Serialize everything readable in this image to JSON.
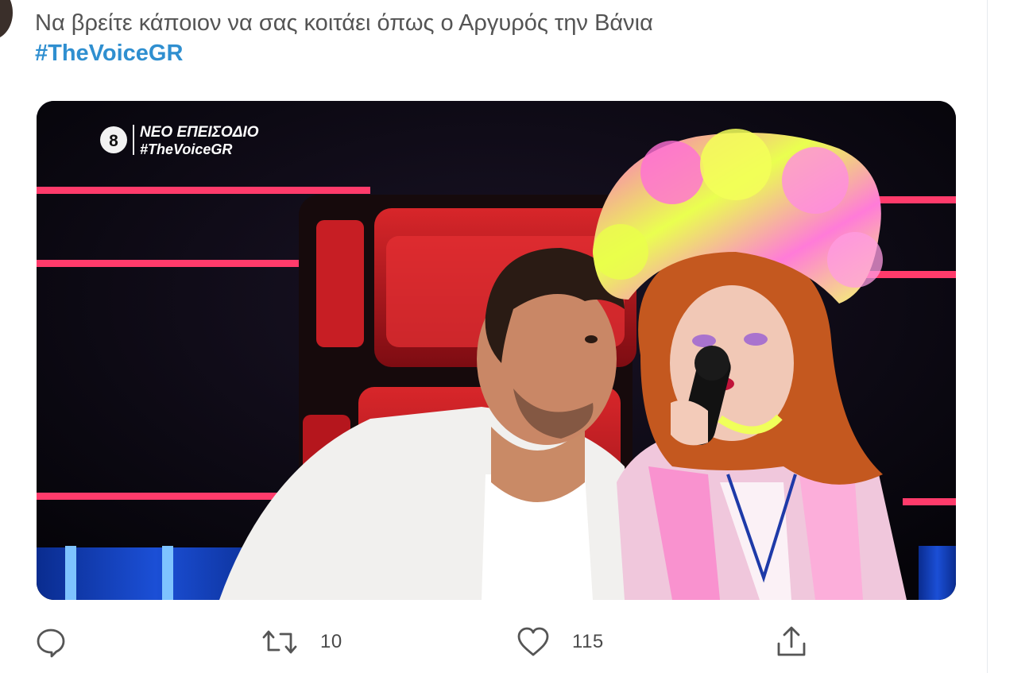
{
  "tweet": {
    "text": "Να βρείτε κάποιον να σας κοιτάει όπως ο Αργυρός την Βάνια",
    "hashtag": "#TheVoiceGR"
  },
  "media": {
    "badge_number": "8",
    "overlay_title": "ΝΕΟ ΕΠΕΙΣΟΔΙΟ",
    "overlay_hashtag": "#TheVoiceGR"
  },
  "actions": {
    "reply": {
      "icon": "reply-icon",
      "count": ""
    },
    "retweet": {
      "icon": "retweet-icon",
      "count": "10"
    },
    "like": {
      "icon": "heart-icon",
      "count": "115"
    },
    "share": {
      "icon": "share-icon",
      "count": ""
    }
  },
  "colors": {
    "hashtag": "#2f8fd0",
    "text": "#545454",
    "icon": "#555555"
  }
}
